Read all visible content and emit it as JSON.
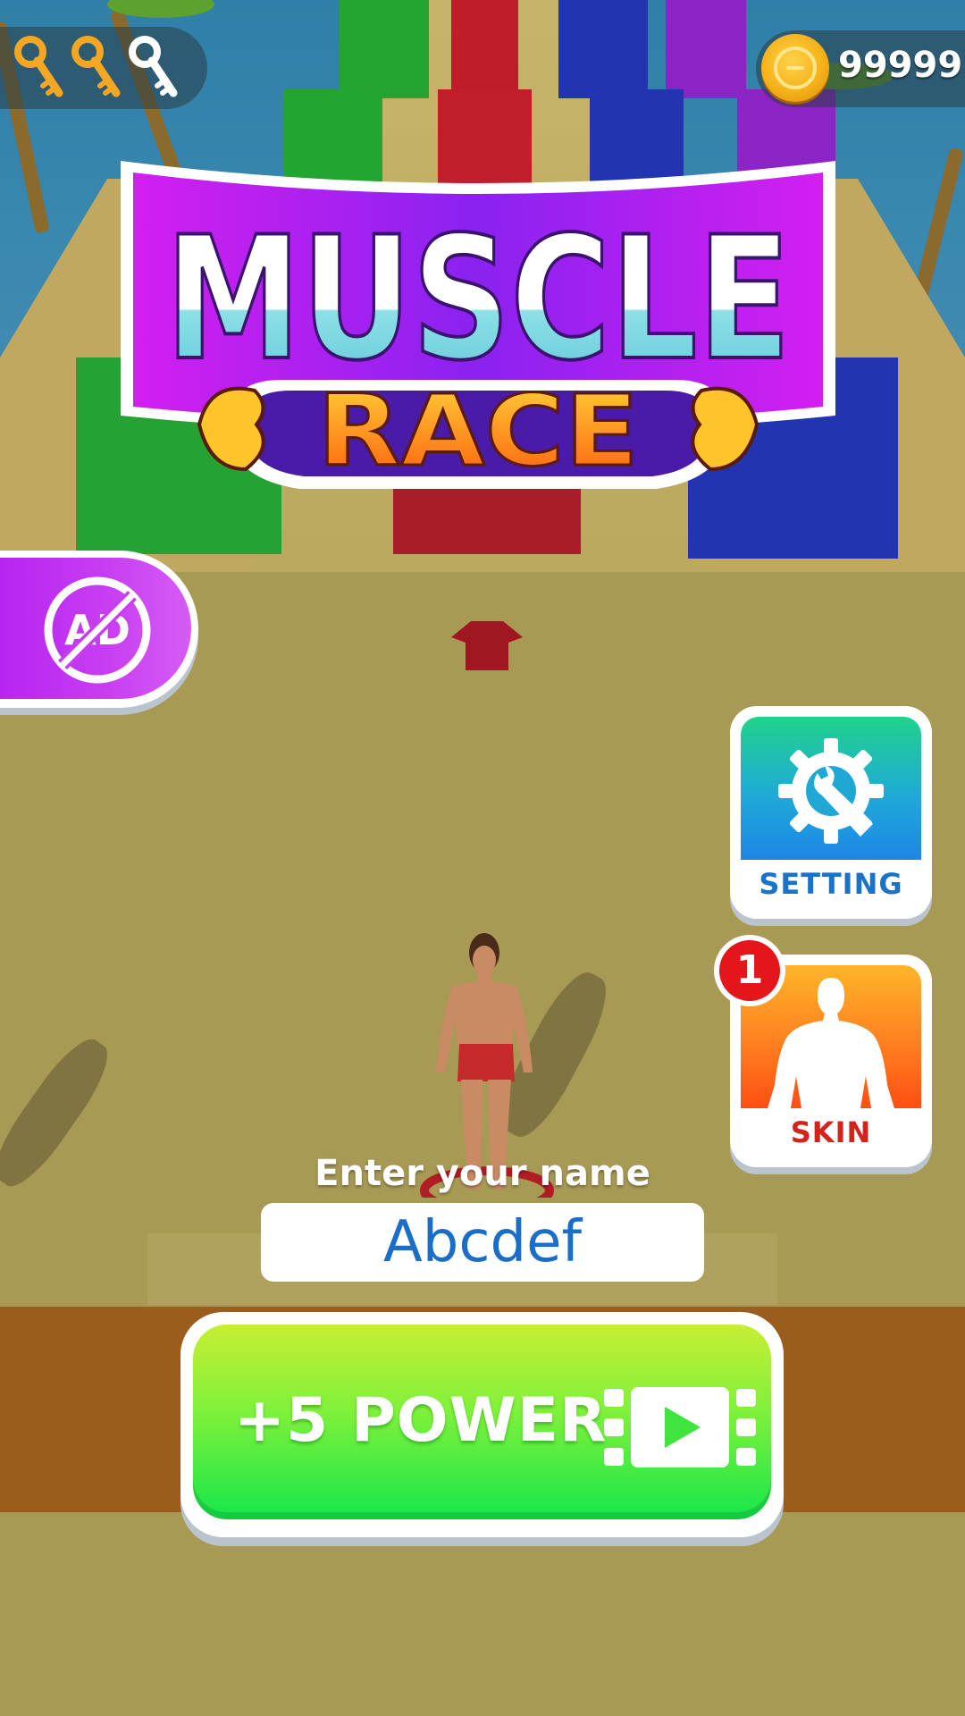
{
  "hud": {
    "keys_collected": 2,
    "keys_total": 3,
    "coin_count": "99999"
  },
  "logo": {
    "title_line1": "MUSCLE",
    "title_line2": "RACE"
  },
  "no_ads": {
    "icon_text": "AD"
  },
  "side_buttons": {
    "setting_label": "SETTING",
    "skin_label": "SKIN",
    "skin_badge": "1"
  },
  "name_entry": {
    "prompt": "Enter your name",
    "value": "Abcdef"
  },
  "power_button": {
    "label": "+5 POWER"
  },
  "colors": {
    "key_collected": "#f5a623",
    "key_empty": "#ffffff",
    "coin_text": "#ffffff",
    "name_text": "#1a6ec7",
    "power_green": "#16e64a",
    "setting_blue": "#1b73c9",
    "skin_red": "#d3231b",
    "no_ads_purple": "#b21df0"
  },
  "icons": [
    "key-icon",
    "coin-icon",
    "no-ads-icon",
    "gear-wrench-icon",
    "muscle-silhouette-icon",
    "video-play-icon"
  ]
}
